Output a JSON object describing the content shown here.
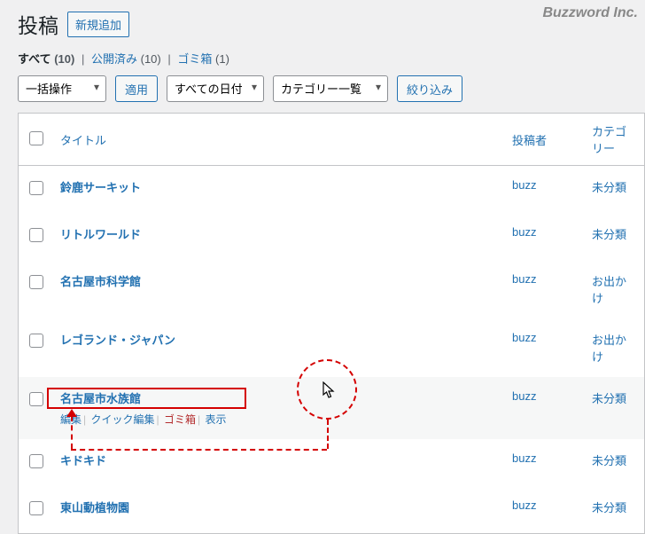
{
  "brand": "Buzzword Inc.",
  "page_title": "投稿",
  "add_new_label": "新規追加",
  "filters": {
    "all": {
      "label": "すべて",
      "count": "(10)"
    },
    "published": {
      "label": "公開済み",
      "count": "(10)"
    },
    "trash": {
      "label": "ゴミ箱",
      "count": "(1)"
    }
  },
  "tablenav": {
    "bulk_action": "一括操作",
    "apply": "適用",
    "all_dates": "すべての日付",
    "cat_list": "カテゴリー一覧",
    "filter": "絞り込み"
  },
  "columns": {
    "title": "タイトル",
    "author": "投稿者",
    "categories": "カテゴリー"
  },
  "row_actions": {
    "edit": "編集",
    "quick_edit": "クイック編集",
    "trash": "ゴミ箱",
    "view": "表示"
  },
  "posts": [
    {
      "title": "鈴鹿サーキット",
      "author": "buzz",
      "cat": "未分類"
    },
    {
      "title": "リトルワールド",
      "author": "buzz",
      "cat": "未分類"
    },
    {
      "title": "名古屋市科学館",
      "author": "buzz",
      "cat": "お出かけ"
    },
    {
      "title": "レゴランド・ジャパン",
      "author": "buzz",
      "cat": "お出かけ"
    },
    {
      "title": "名古屋市水族館",
      "author": "buzz",
      "cat": "未分類"
    },
    {
      "title": "キドキド",
      "author": "buzz",
      "cat": "未分類"
    },
    {
      "title": "東山動植物園",
      "author": "buzz",
      "cat": "未分類"
    }
  ]
}
